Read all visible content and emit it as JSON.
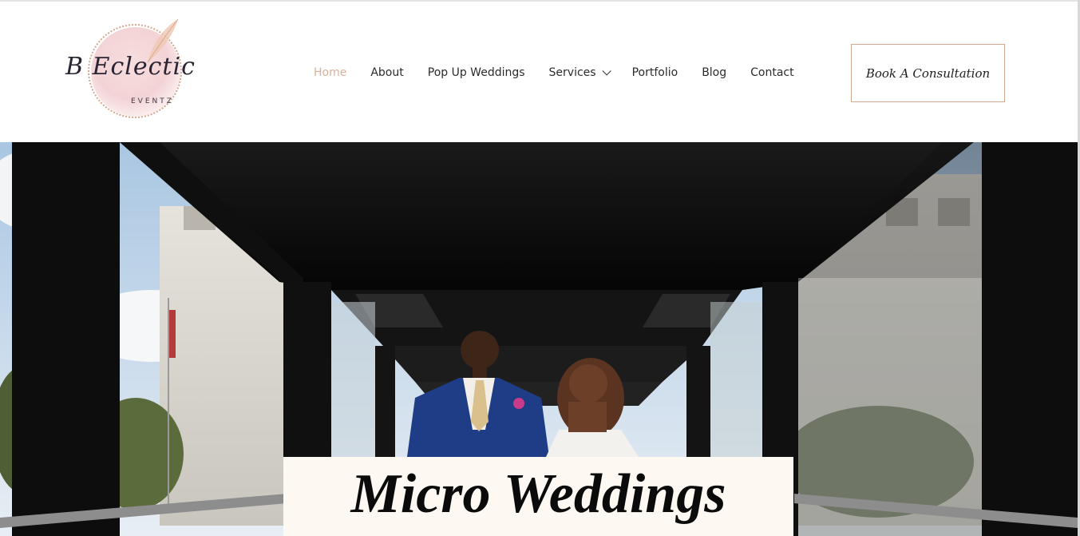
{
  "brand": {
    "script_name": "B Eclectic",
    "sub_name": "EVENTZ"
  },
  "nav": {
    "items": [
      {
        "label": "Home",
        "active": true
      },
      {
        "label": "About"
      },
      {
        "label": "Pop Up Weddings"
      },
      {
        "label": "Services",
        "has_dropdown": true
      },
      {
        "label": "Portfolio"
      },
      {
        "label": "Blog"
      },
      {
        "label": "Contact"
      }
    ],
    "cta_label": "Book A Consultation"
  },
  "hero": {
    "title": "Micro Weddings",
    "image_description_icon": "wedding-couple-photo"
  },
  "colors": {
    "accent": "#d9b19a",
    "cta_border": "#d4a98e",
    "title_box": "#fdf9f2",
    "text": "#2b2b2b"
  }
}
